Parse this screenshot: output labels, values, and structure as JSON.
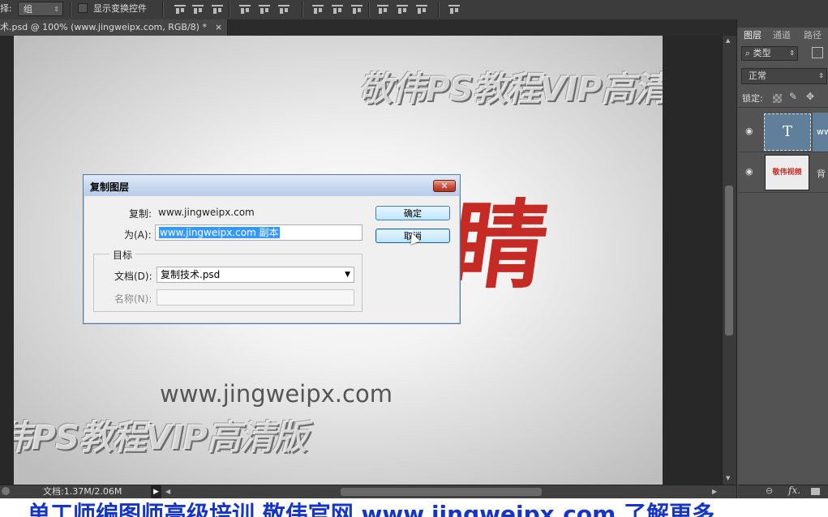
{
  "options_bar": {
    "mode_label": "择:",
    "group_value": "组",
    "show_transform_label": "显示变换控件"
  },
  "document": {
    "tab_title": "术.psd @ 100% (www.jingweipx.com, RGB/8) *",
    "tab_close": "×",
    "status_text": "文档:1.37M/2.06M"
  },
  "canvas": {
    "watermark_top": "敬伟PS教程VIP高清版",
    "watermark_bottom": "伟PS教程VIP高清版",
    "red_art_text": "睛",
    "url_text": "www.jingweipx.com"
  },
  "panels": {
    "tabs": [
      "图层",
      "通道",
      "路径"
    ],
    "filter_label": "类型",
    "blend_mode": "正常",
    "lock_label": "锁定:",
    "layers": [
      {
        "thumb_text": "T",
        "name": "ww",
        "selected": true
      },
      {
        "thumb_text": "敬伟视频",
        "name": "背",
        "selected": false
      }
    ]
  },
  "dialog": {
    "title": "复制图层",
    "copy_label": "复制:",
    "copy_value": "www.jingweipx.com",
    "as_label": "为(A):",
    "as_value": "www.jingweipx.com 副本",
    "ok_button": "确定",
    "cancel_button": "取消",
    "target_group": "目标",
    "document_label": "文档(D):",
    "document_value": "复制技术.psd",
    "name_label": "名称(N):",
    "name_value": ""
  },
  "subtitle": "单工师编图师高级培训 敬伟官网 www.jingweipx.com 了解更多",
  "colors": {
    "accent_red": "#c52a24",
    "subtitle_blue": "#1535c8",
    "selection_blue": "#3399ff"
  }
}
